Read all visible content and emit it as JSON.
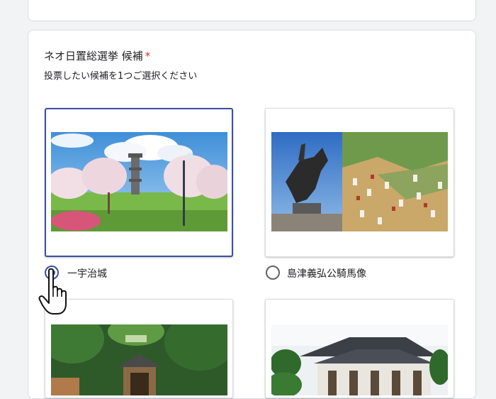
{
  "question": {
    "title": "ネオ日置総選挙 候補",
    "required_mark": "*",
    "description": "投票したい候補を1つご選択ください"
  },
  "options": [
    {
      "label": "一宇治城",
      "selected": true
    },
    {
      "label": "島津義弘公騎馬像",
      "selected": false
    }
  ],
  "colors": {
    "accent": "#3c4ea6",
    "required": "#d93025",
    "page_background": "#f1f3f4"
  }
}
